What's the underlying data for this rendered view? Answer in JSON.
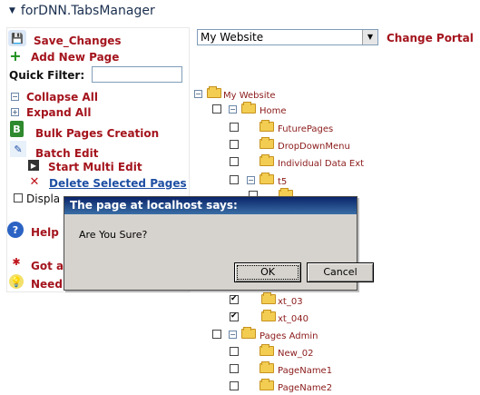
{
  "header": {
    "title": "forDNN.TabsManager"
  },
  "left_menu": {
    "save_changes": "Save_Changes",
    "add_new_page": "Add New Page",
    "quick_filter_label": "Quick Filter:",
    "quick_filter_value": "",
    "collapse_all": "Collapse All",
    "expand_all": "Expand All",
    "bulk_pages_creation": "Bulk Pages Creation",
    "batch_edit": "Batch Edit",
    "start_multi_edit": "Start Multi Edit",
    "delete_selected_pages": "Delete Selected Pages",
    "display_partial": "Displa",
    "help_partial": "Help",
    "got_partial": "Got a",
    "need_partial": "Need"
  },
  "portal": {
    "selected": "My Website",
    "change_label": "Change Portal"
  },
  "tree": {
    "root": "My Website",
    "home": "Home",
    "future_pages": "FuturePages",
    "dropdown_menu": "DropDownMenu",
    "individual_data_ext": "Individual Data Ext",
    "t5": "t5",
    "xt_03": "xt_03",
    "xt_040": "xt_040",
    "pages_admin": "Pages Admin",
    "new_02": "New_02",
    "pagename1": "PageName1",
    "pagename2": "PageName2"
  },
  "dialog": {
    "title": "The page at localhost says:",
    "message": "Are You Sure?",
    "ok": "OK",
    "cancel": "Cancel"
  },
  "colors": {
    "accent_red": "#a4141d",
    "link_blue": "#1e4fa3",
    "title_blue": "#1a2f4f"
  }
}
